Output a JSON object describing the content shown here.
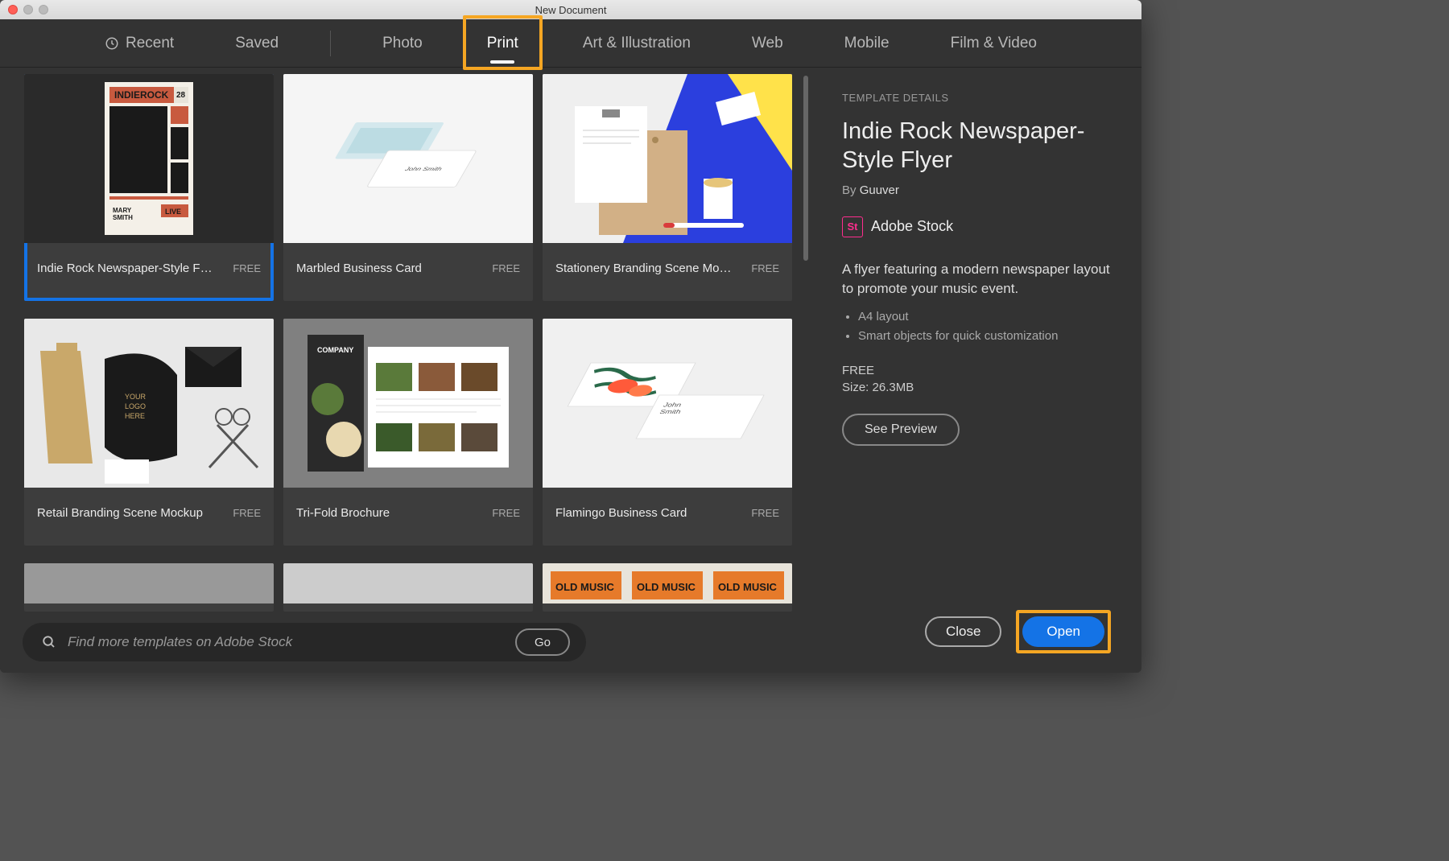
{
  "window": {
    "title": "New Document"
  },
  "tabs": [
    {
      "id": "recent",
      "label": "Recent",
      "icon": "clock",
      "active": false
    },
    {
      "id": "saved",
      "label": "Saved",
      "active": false
    },
    {
      "id": "photo",
      "label": "Photo",
      "active": false
    },
    {
      "id": "print",
      "label": "Print",
      "active": true,
      "highlighted": true
    },
    {
      "id": "art",
      "label": "Art & Illustration",
      "active": false
    },
    {
      "id": "web",
      "label": "Web",
      "active": false
    },
    {
      "id": "mobile",
      "label": "Mobile",
      "active": false
    },
    {
      "id": "film",
      "label": "Film & Video",
      "active": false
    }
  ],
  "templates": [
    {
      "title": "Indie Rock Newspaper-Style Flyer",
      "badge": "FREE",
      "selected": true,
      "highlighted": true,
      "thumb": "indierock"
    },
    {
      "title": "Marbled Business Card",
      "badge": "FREE",
      "thumb": "marbled"
    },
    {
      "title": "Stationery Branding Scene Mock…",
      "badge": "FREE",
      "thumb": "stationery"
    },
    {
      "title": "Retail Branding Scene Mockup",
      "badge": "FREE",
      "thumb": "retail"
    },
    {
      "title": "Tri-Fold Brochure",
      "badge": "FREE",
      "thumb": "trifold"
    },
    {
      "title": "Flamingo Business Card",
      "badge": "FREE",
      "thumb": "flamingo"
    },
    {
      "title": "",
      "badge": "",
      "partial": true,
      "thumb": "gray"
    },
    {
      "title": "",
      "badge": "",
      "partial": true,
      "thumb": "gray2"
    },
    {
      "title": "",
      "badge": "",
      "partial": true,
      "thumb": "oldmusic"
    }
  ],
  "search": {
    "placeholder": "Find more templates on Adobe Stock",
    "go": "Go"
  },
  "details": {
    "label": "TEMPLATE DETAILS",
    "title": "Indie Rock Newspaper-Style Flyer",
    "by": "By",
    "author": "Guuver",
    "stock_badge": "St",
    "stock_label": "Adobe Stock",
    "description": "A flyer featuring a modern newspaper layout to promote your music event.",
    "bullets": [
      "A4 layout",
      "Smart objects for quick customization"
    ],
    "price": "FREE",
    "size_label": "Size:",
    "size_value": "26.3MB",
    "preview": "See Preview"
  },
  "footer": {
    "close": "Close",
    "open": "Open"
  }
}
